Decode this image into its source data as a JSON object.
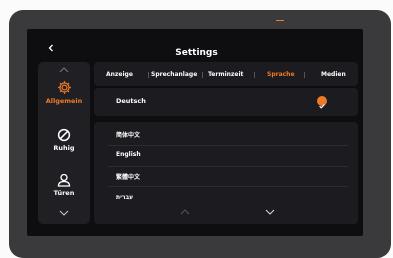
{
  "header": {
    "back_icon": "chevron-left-icon",
    "title": "Settings"
  },
  "sidebar": {
    "items": [
      {
        "label": "Allgemein",
        "icon": "gear-icon",
        "active": true
      },
      {
        "label": "Ruhig",
        "icon": "do-not-disturb-icon",
        "active": false
      },
      {
        "label": "Türen",
        "icon": "user-icon",
        "active": false
      }
    ]
  },
  "tabs": [
    {
      "label": "Anzeige",
      "active": false
    },
    {
      "label": "Sprechanlage",
      "active": false
    },
    {
      "label": "Terminzeit",
      "active": false
    },
    {
      "label": "Sprache",
      "active": true
    },
    {
      "label": "Medien",
      "active": false
    }
  ],
  "current_language": {
    "label": "Deutsch",
    "selected": true
  },
  "languages": [
    "简体中文",
    "English",
    "繁體中文",
    "עברית"
  ],
  "colors": {
    "accent": "#ee7a28",
    "panel": "#1c1c20",
    "background": "#0e0e10"
  }
}
